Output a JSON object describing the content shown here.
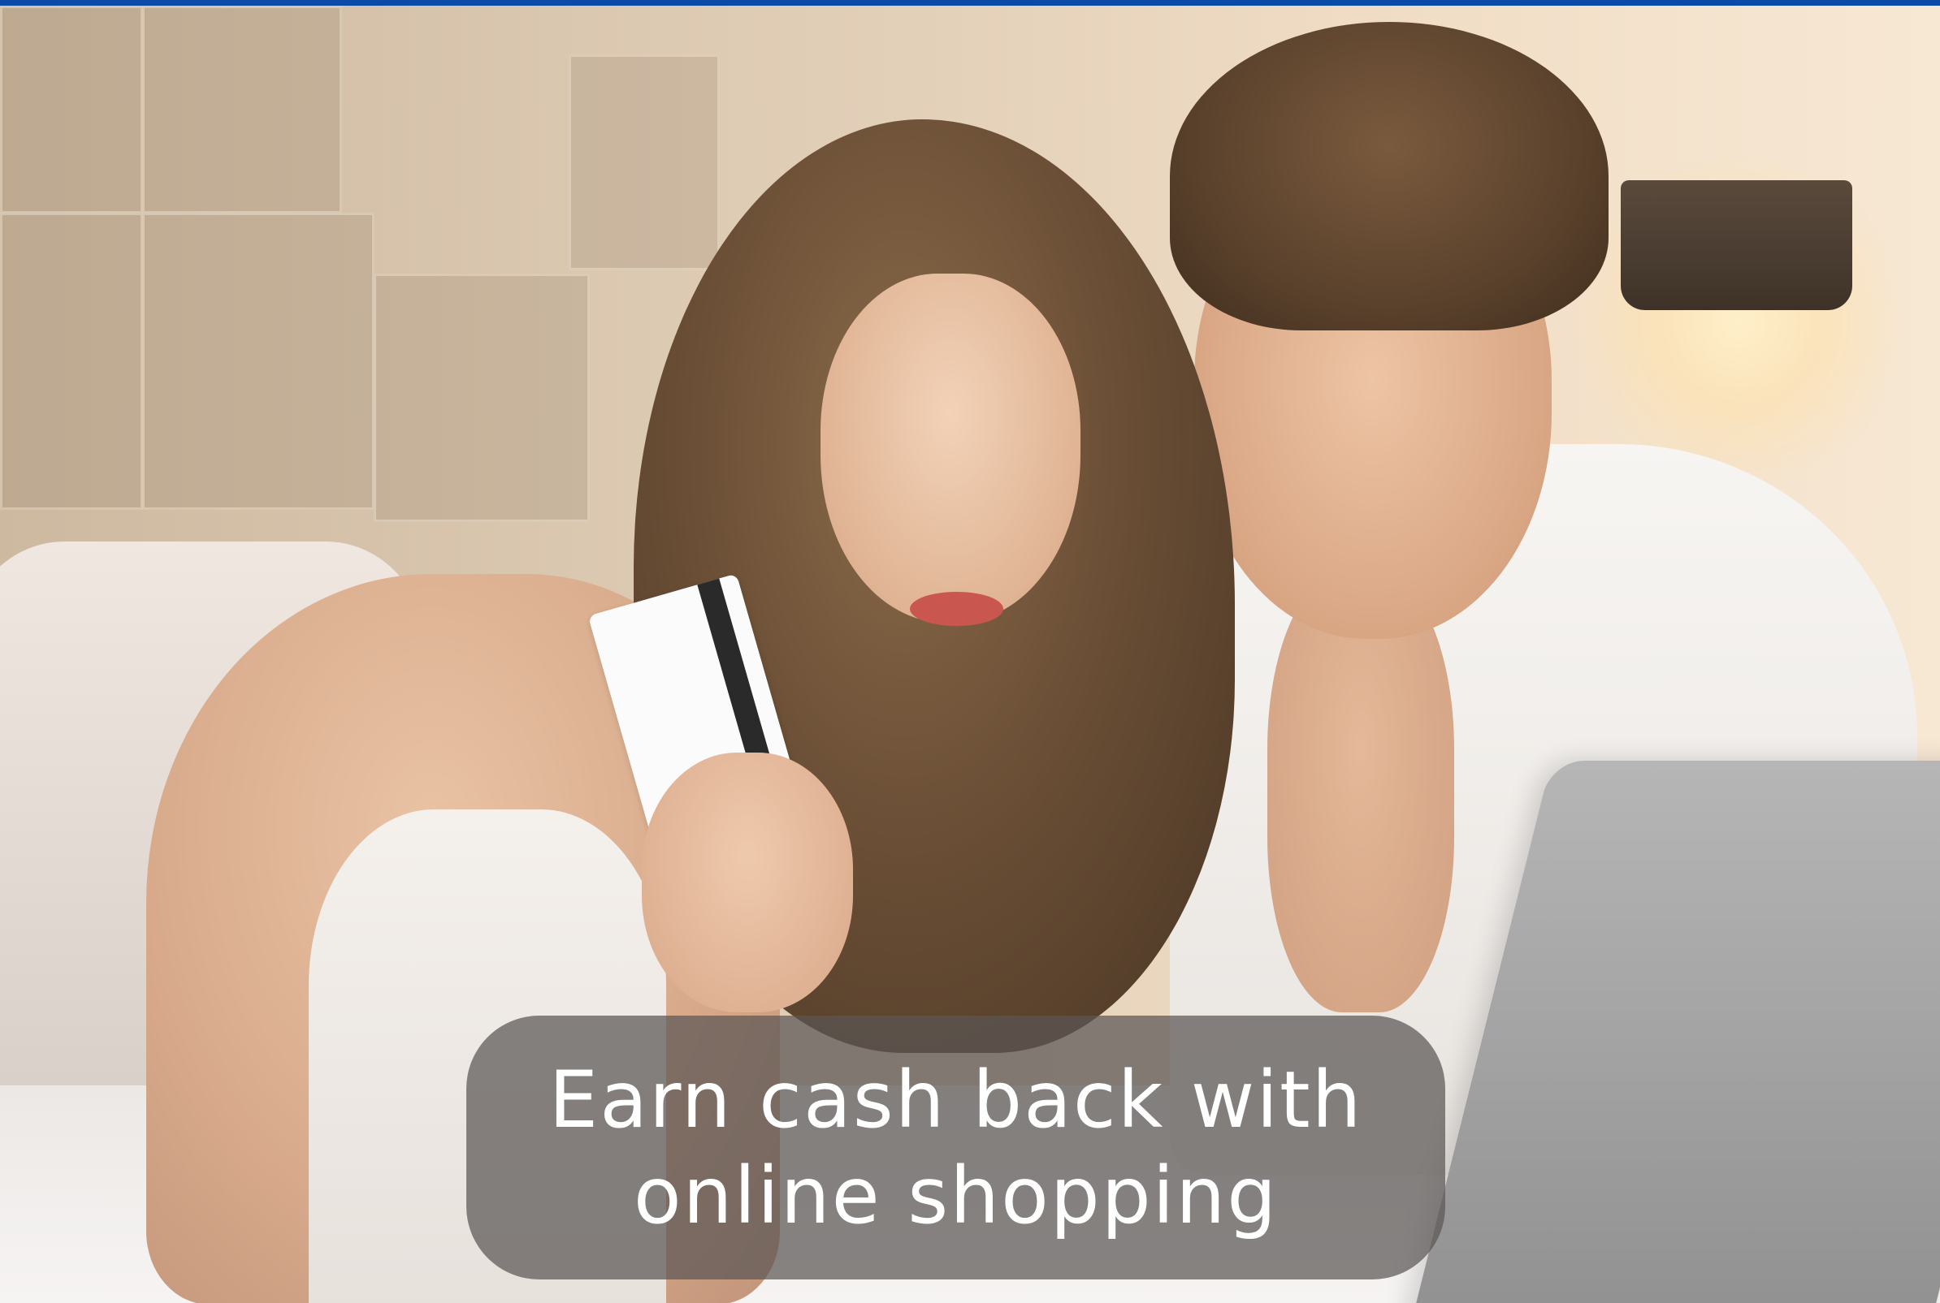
{
  "banner": {
    "image_alt": "",
    "caption": {
      "line1": "Earn cash back with",
      "line2": "online shopping"
    }
  },
  "colors": {
    "top_accent": "#0c4aa8",
    "caption_background": "#5a5654",
    "caption_text": "#ffffff"
  }
}
